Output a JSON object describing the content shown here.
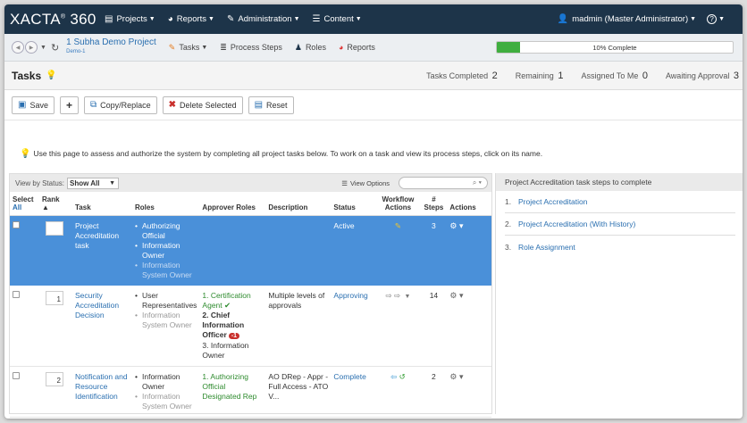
{
  "brand": {
    "name": "XACTA",
    "reg": "®",
    "version": "360"
  },
  "topnav": [
    {
      "label": "Projects",
      "icon": "projects-icon"
    },
    {
      "label": "Reports",
      "icon": "reports-icon"
    },
    {
      "label": "Administration",
      "icon": "wrench-icon"
    },
    {
      "label": "Content",
      "icon": "database-icon"
    }
  ],
  "user": {
    "label": "madmin (Master Administrator)",
    "help": "?"
  },
  "subnav": {
    "project_name": "1 Subha Demo Project",
    "project_sub": "Demo-1",
    "items": [
      "Tasks",
      "Process Steps",
      "Roles",
      "Reports"
    ]
  },
  "progress": {
    "value": 0.1,
    "label": "10% Complete"
  },
  "page": {
    "title": "Tasks"
  },
  "stats": {
    "completed_label": "Tasks Completed",
    "completed": "2",
    "remaining_label": "Remaining",
    "remaining": "1",
    "assigned_label": "Assigned To Me",
    "assigned": "0",
    "approval_label": "Awaiting Approval",
    "approval": "3"
  },
  "toolbar": {
    "save": "Save",
    "add": "+",
    "copy": "Copy/Replace",
    "delete": "Delete Selected",
    "reset": "Reset"
  },
  "hint": "Use this page to assess and authorize the system by completing all project tasks below. To work on a task and view its process steps, click on its name.",
  "filter": {
    "label": "View by Status:",
    "value": "Show All",
    "view_options": "View Options"
  },
  "table": {
    "headers": {
      "select": "Select",
      "all": "All",
      "rank": "Rank",
      "task": "Task",
      "roles": "Roles",
      "approver": "Approver Roles",
      "description": "Description",
      "status": "Status",
      "workflow": "Workflow Actions",
      "steps_hash": "#",
      "steps": "Steps",
      "actions": "Actions"
    },
    "rows": [
      {
        "rank": "",
        "task": "Project Accreditation task",
        "roles": [
          "Authorizing Official",
          "Information Owner"
        ],
        "roles_muted": [
          "Information System Owner"
        ],
        "approvers": [],
        "description": "",
        "status": "Active",
        "steps": "3"
      },
      {
        "rank": "1",
        "task": "Security Accreditation Decision",
        "roles": [
          "User Representatives"
        ],
        "roles_muted": [
          "Information System Owner"
        ],
        "approvers": [
          {
            "text": "1. Certification Agent ✔",
            "style": "green"
          },
          {
            "text": "2. Chief Information Officer",
            "style": "bold",
            "badge": "-1"
          },
          {
            "text": "3. Information Owner",
            "style": "normal"
          }
        ],
        "description": "Multiple levels of approvals",
        "status": "Approving",
        "steps": "14"
      },
      {
        "rank": "2",
        "task": "Notification and Resource Identification",
        "roles": [
          "Information Owner"
        ],
        "roles_muted": [
          "Information System Owner"
        ],
        "approvers": [
          {
            "text": "1. Authorizing Official Designated Rep",
            "style": "green"
          }
        ],
        "description": "AO DRep - Appr - Full Access - ATO V...",
        "status": "Complete",
        "steps": "2"
      }
    ]
  },
  "right_panel": {
    "title": "Project Accreditation task steps to complete",
    "steps": [
      {
        "n": "1.",
        "label": "Project Accreditation"
      },
      {
        "n": "2.",
        "label": "Project Accreditation (With History)"
      },
      {
        "n": "3.",
        "label": "Role Assignment"
      }
    ]
  }
}
